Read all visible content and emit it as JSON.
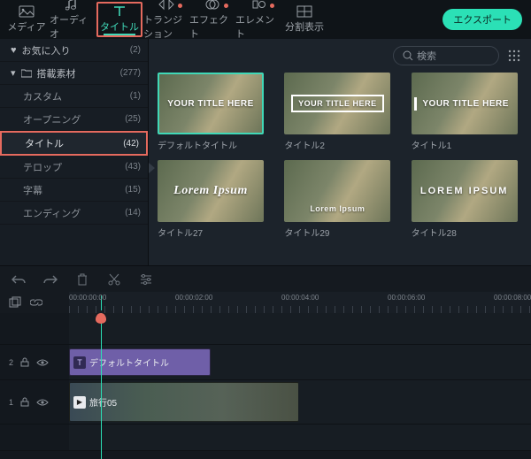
{
  "topbar": {
    "tabs": [
      {
        "label": "メディア",
        "icon": "media",
        "dot": false
      },
      {
        "label": "オーディオ",
        "icon": "audio",
        "dot": false
      },
      {
        "label": "タイトル",
        "icon": "title",
        "dot": false,
        "active": true,
        "highlight": true
      },
      {
        "label": "トランジション",
        "icon": "transition",
        "dot": true
      },
      {
        "label": "エフェクト",
        "icon": "effect",
        "dot": true
      },
      {
        "label": "エレメント",
        "icon": "element",
        "dot": true
      },
      {
        "label": "分割表示",
        "icon": "split",
        "dot": false
      }
    ],
    "export_label": "エクスポート"
  },
  "sidebar": {
    "items": [
      {
        "label": "お気に入り",
        "count": "(2)",
        "icon": "heart"
      },
      {
        "label": "搭載素材",
        "count": "(277)",
        "icon": "folder",
        "caret": true
      },
      {
        "label": "カスタム",
        "count": "(1)",
        "indent": true
      },
      {
        "label": "オープニング",
        "count": "(25)",
        "indent": true
      },
      {
        "label": "タイトル",
        "count": "(42)",
        "indent": true,
        "highlight": true
      },
      {
        "label": "テロップ",
        "count": "(43)",
        "indent": true
      },
      {
        "label": "字幕",
        "count": "(15)",
        "indent": true
      },
      {
        "label": "エンディング",
        "count": "(14)",
        "indent": true
      }
    ]
  },
  "search": {
    "placeholder": "検索"
  },
  "thumbs": [
    {
      "overlay": "YOUR TITLE HERE",
      "style": "plain",
      "caption": "デフォルトタイトル",
      "selected": true
    },
    {
      "overlay": "YOUR TITLE HERE",
      "style": "box",
      "caption": "タイトル2"
    },
    {
      "overlay": "YOUR TITLE HERE",
      "style": "pipe",
      "caption": "タイトル1"
    },
    {
      "overlay": "Lorem Ipsum",
      "style": "script",
      "caption": "タイトル27"
    },
    {
      "overlay": "Lorem Ipsum",
      "style": "lower",
      "caption": "タイトル29"
    },
    {
      "overlay": "LOREM IPSUM",
      "style": "spaced",
      "caption": "タイトル28"
    }
  ],
  "ruler": {
    "labels": [
      "00:00:00:00",
      "00:00:02:00",
      "00:00:04:00",
      "00:00:06:00",
      "00:00:08:00"
    ]
  },
  "tracks": {
    "title_clip": "デフォルトタイトル",
    "video_clip": "旅行05",
    "track2": "2",
    "track1": "1"
  }
}
